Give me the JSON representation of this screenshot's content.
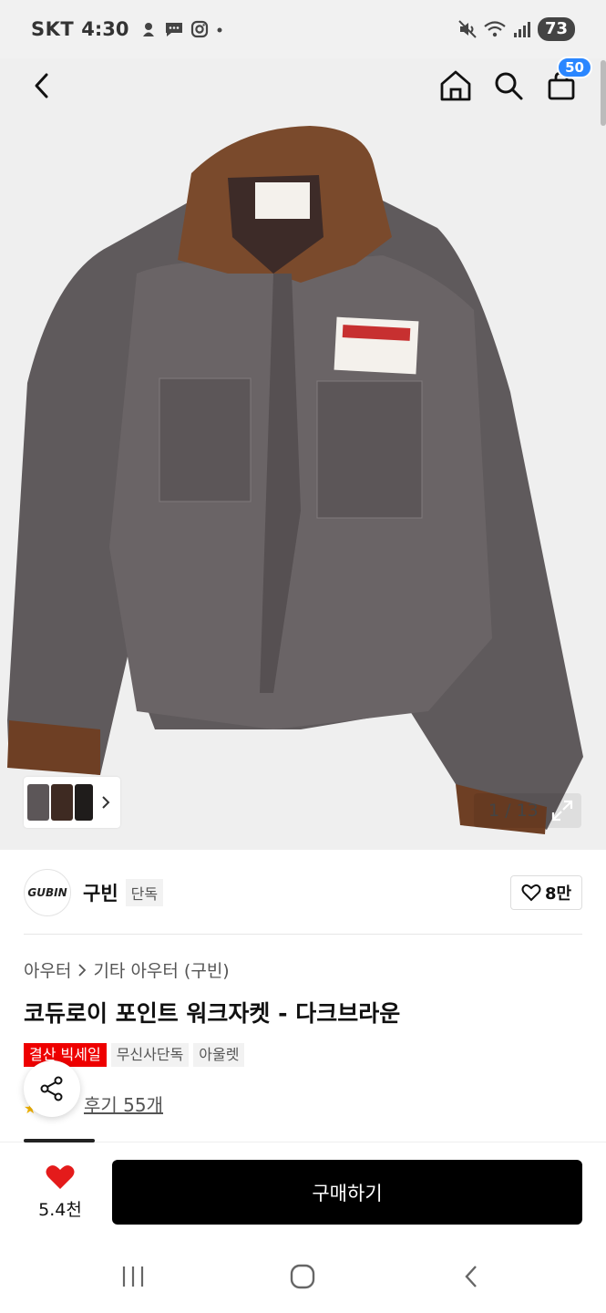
{
  "status_bar": {
    "carrier": "SKT",
    "time": "4:30",
    "battery": "73",
    "icons": [
      "kakao-icon",
      "message-icon",
      "instagram-icon",
      "dot-icon",
      "mute-icon",
      "wifi-icon",
      "signal-icon"
    ]
  },
  "nav": {
    "back_icon": "chevron-left-icon",
    "home_icon": "home-icon",
    "search_icon": "search-icon",
    "cart_icon": "shopping-bag-icon",
    "cart_count": "50"
  },
  "gallery": {
    "counter": "1 / 13",
    "expand_icon": "expand-icon"
  },
  "shop": {
    "name": "구빈",
    "logo_text": "GUBIN",
    "tag": "단독",
    "likes": "8만"
  },
  "breadcrumb": {
    "category": "아우터",
    "subcategory": "기타 아우터 (구빈)"
  },
  "product": {
    "title": "코듀로이 포인트 워크자켓 - 다크브라운",
    "badges": [
      "결산 빅세일",
      "무신사단독",
      "아울렛"
    ],
    "review_text": "후기 55개"
  },
  "bottom": {
    "wish_count": "5.4천",
    "buy_label": "구매하기"
  },
  "colors": {
    "accent_blue": "#2a86ff",
    "sale_red": "#e00000",
    "heart_red": "#e41b1b",
    "buy_black": "#000000"
  }
}
